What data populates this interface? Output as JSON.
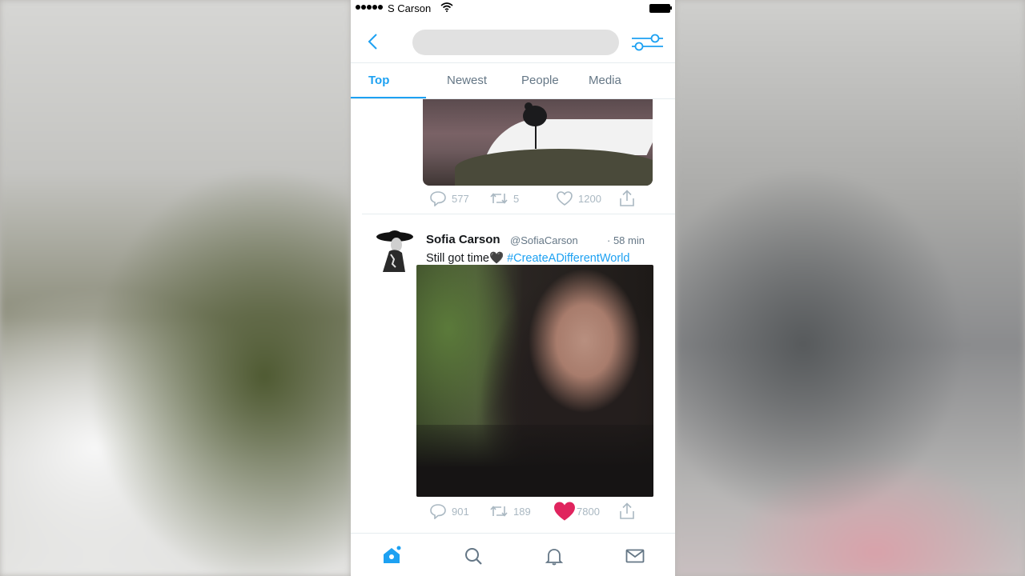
{
  "status_bar": {
    "carrier": "S Carson",
    "icons": [
      "signal-dots-icon",
      "wifi-icon",
      "battery-icon"
    ]
  },
  "nav_bar": {
    "back_icon": "chevron-left-icon",
    "search_placeholder": "",
    "filter_icon": "sliders-icon"
  },
  "tabs": [
    {
      "label": "Top",
      "active": true
    },
    {
      "label": "Newest",
      "active": false
    },
    {
      "label": "People",
      "active": false
    },
    {
      "label": "Media",
      "active": false
    }
  ],
  "tweets": [
    {
      "actions": {
        "replies": "577",
        "retweets": "5",
        "likes": "1200",
        "liked": false
      }
    },
    {
      "name": "Sofia Carson",
      "handle": "@SofiaCarson",
      "time": "· 58 min",
      "text": "Still got time🖤",
      "hashtag": "#CreateADifferentWorld",
      "actions": {
        "replies": "901",
        "retweets": "189",
        "likes": "7800",
        "liked": true
      }
    }
  ],
  "tab_bar": [
    "home-icon",
    "search-icon",
    "notifications-bell-icon",
    "messages-envelope-icon"
  ],
  "colors": {
    "accent": "#1da1f2",
    "like": "#e0245e",
    "muted": "#aab8c2"
  }
}
